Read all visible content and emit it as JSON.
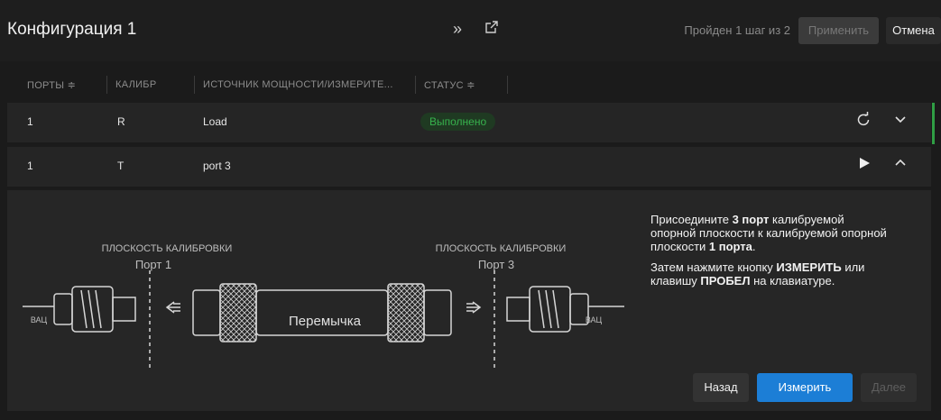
{
  "header": {
    "title": "Конфигурация 1",
    "step_text": "Пройден 1 шаг из 2",
    "apply_label": "Применить",
    "cancel_label": "Отмена",
    "icons": [
      "double-chevron-right-icon",
      "open-external-icon"
    ]
  },
  "table": {
    "columns": [
      "ПОРТЫ ≑",
      "КАЛИБР",
      "ИСТОЧНИК МОЩНОСТИ/ИЗМЕРИТЕ...",
      "СТАТУС ≑"
    ],
    "rows": [
      {
        "port": "1",
        "standard": "R",
        "source": "Load",
        "status": "Выполнено"
      },
      {
        "port": "1",
        "standard": "T",
        "source": "port 3",
        "status": ""
      }
    ]
  },
  "diagram": {
    "plane_label": "ПЛОСКОСТЬ КАЛИБРОВКИ",
    "port_left": "Порт 1",
    "port_right": "Порт 3",
    "vna": "ВАЦ",
    "thru": "Перемычка"
  },
  "instructions": {
    "p1_a": "Присоедините ",
    "p1_b": "3 порт",
    "p1_c": " калибруемой опорной плоскости к калибруемой опорной плоскости ",
    "p1_d": "1 порта",
    "p1_e": ".",
    "p2_a": "Затем нажмите кнопку ",
    "p2_b": "ИЗМЕРИТЬ",
    "p2_c": " или клавишу ",
    "p2_d": "ПРОБЕЛ",
    "p2_e": " на клавиатуре."
  },
  "footer": {
    "back_label": "Назад",
    "measure_label": "Измерить",
    "next_label": "Далее"
  },
  "colors": {
    "background": "#1b1b1b",
    "accent": "#1c7ed6",
    "success": "#37b24d"
  }
}
